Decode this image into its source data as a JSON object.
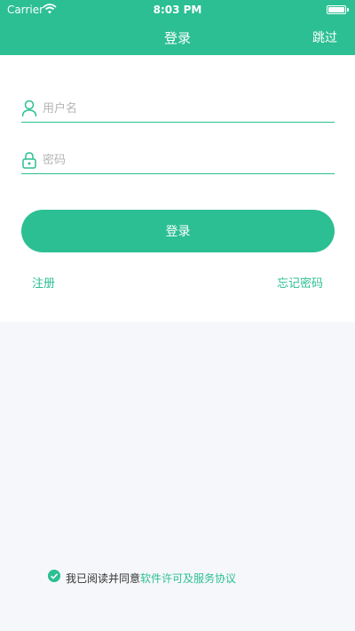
{
  "status_bar": {
    "carrier": "Carrier",
    "time": "8:03 PM"
  },
  "header": {
    "title": "登录",
    "skip_label": "跳过"
  },
  "form": {
    "username_placeholder": "用户名",
    "username_value": "",
    "password_placeholder": "密码",
    "password_value": "",
    "login_label": "登录"
  },
  "links": {
    "register": "注册",
    "forgot_password": "忘记密码"
  },
  "agreement": {
    "text": "我已阅读并同意",
    "link_text": "软件许可及服务协议",
    "checked": true
  },
  "colors": {
    "accent": "#2cbf93",
    "background": "#f6f7fa"
  }
}
